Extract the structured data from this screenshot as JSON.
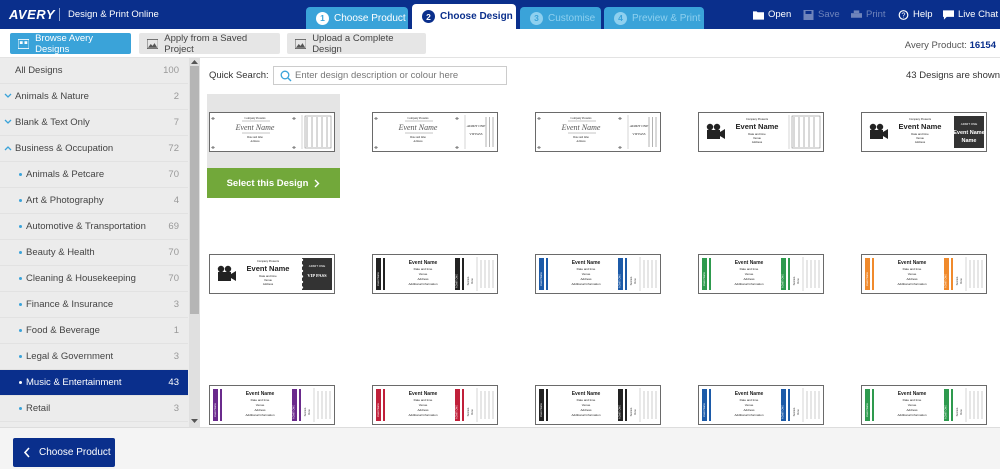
{
  "header": {
    "logo": "AVERY",
    "subtitle": "Design & Print Online",
    "steps": [
      {
        "num": "1",
        "label": "Choose Product",
        "state": "done"
      },
      {
        "num": "2",
        "label": "Choose Design",
        "state": "active"
      },
      {
        "num": "3",
        "label": "Customise",
        "state": "pending"
      },
      {
        "num": "4",
        "label": "Preview & Print",
        "state": "pending"
      }
    ],
    "tools": {
      "open": "Open",
      "save": "Save",
      "print": "Print",
      "help": "Help",
      "chat": "Live Chat"
    }
  },
  "toolbar": {
    "browse": "Browse Avery Designs",
    "apply_saved": "Apply from a Saved Project",
    "upload": "Upload a Complete Design",
    "product_prefix": "Avery Product:",
    "product_code": "16154"
  },
  "sidebar": {
    "items": [
      {
        "label": "All Designs",
        "count": "100",
        "type": "top"
      },
      {
        "label": "Animals & Nature",
        "count": "2",
        "type": "collapsed"
      },
      {
        "label": "Blank & Text Only",
        "count": "7",
        "type": "collapsed"
      },
      {
        "label": "Business & Occupation",
        "count": "72",
        "type": "expanded"
      },
      {
        "label": "Animals & Petcare",
        "count": "70",
        "type": "sub"
      },
      {
        "label": "Art & Photography",
        "count": "4",
        "type": "sub"
      },
      {
        "label": "Automotive & Transportation",
        "count": "69",
        "type": "sub"
      },
      {
        "label": "Beauty & Health",
        "count": "70",
        "type": "sub"
      },
      {
        "label": "Cleaning & Housekeeping",
        "count": "70",
        "type": "sub"
      },
      {
        "label": "Finance & Insurance",
        "count": "3",
        "type": "sub"
      },
      {
        "label": "Food & Beverage",
        "count": "1",
        "type": "sub"
      },
      {
        "label": "Legal & Government",
        "count": "3",
        "type": "sub"
      },
      {
        "label": "Music & Entertainment",
        "count": "43",
        "type": "sub-selected"
      },
      {
        "label": "Retail",
        "count": "3",
        "type": "sub"
      }
    ]
  },
  "search": {
    "label": "Quick Search:",
    "placeholder": "Enter design description or colour here",
    "value": ""
  },
  "results": {
    "count_text": "43 Designs are shown"
  },
  "select_button": "Select this Design",
  "ticket_text": {
    "company": "Company Presents",
    "event": "Event Name",
    "date": "Date and time",
    "venue": "Venue",
    "address": "Address",
    "additional": "Additional Information",
    "vip": "VIP PASS",
    "admit": "ADMIT ONE",
    "row": "Row",
    "seat": "Seat",
    "section": "Section"
  },
  "designs": [
    {
      "style": "classic"
    },
    {
      "style": "classic-vip"
    },
    {
      "style": "classic-vip"
    },
    {
      "style": "film"
    },
    {
      "style": "film-dark"
    },
    {
      "style": "film-vip"
    },
    {
      "style": "stripe",
      "color": "#222222"
    },
    {
      "style": "stripe",
      "color": "#1c5aa8"
    },
    {
      "style": "stripe",
      "color": "#2e9a4e"
    },
    {
      "style": "stripe",
      "color": "#f08a2c"
    },
    {
      "style": "stripe",
      "color": "#6a2a8c"
    },
    {
      "style": "stripe",
      "color": "#c0203a"
    },
    {
      "style": "stripe",
      "color": "#222222"
    },
    {
      "style": "stripe",
      "color": "#1c5aa8"
    },
    {
      "style": "stripe",
      "color": "#2e9a4e"
    }
  ],
  "footer": {
    "back": "Choose Product"
  }
}
